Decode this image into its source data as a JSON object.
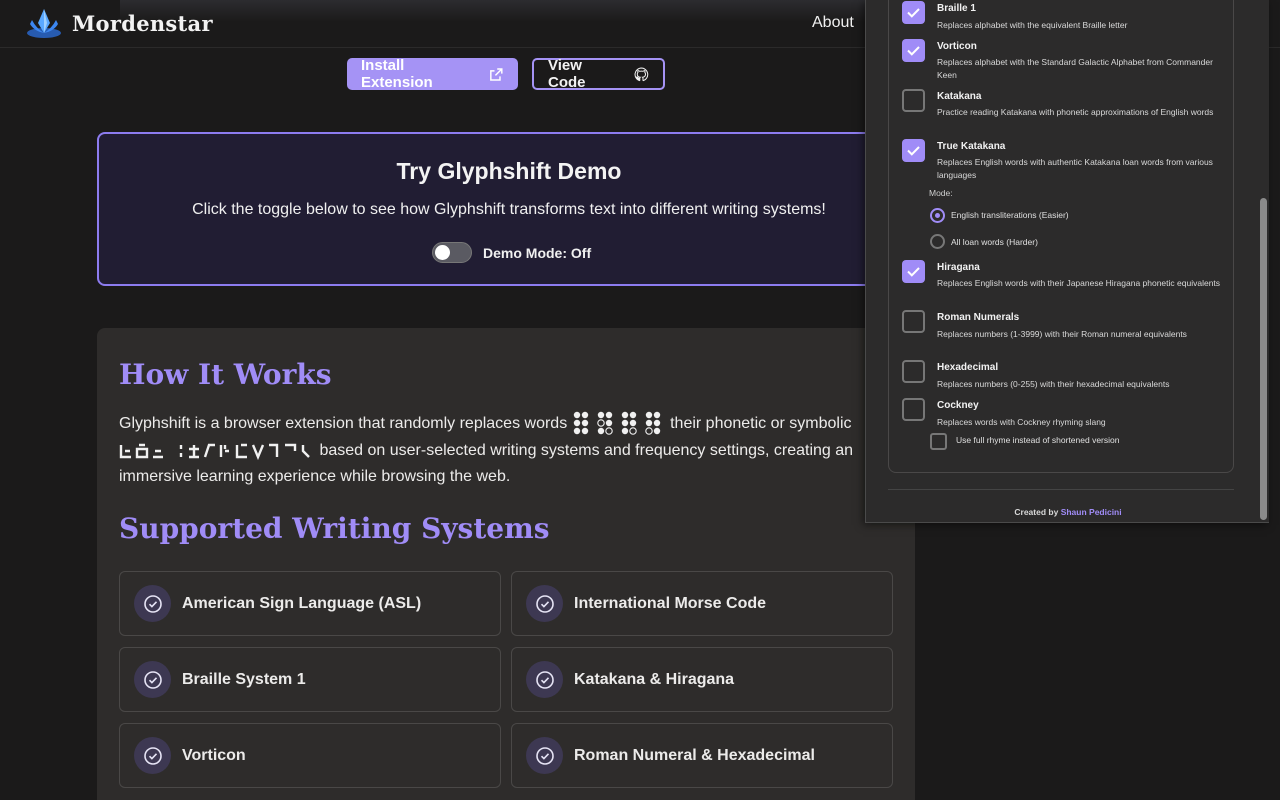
{
  "header": {
    "brand": "Mordenstar",
    "nav_about": "About",
    "install_button": "Install Extension",
    "code_button": "View Code"
  },
  "demo": {
    "title": "Try Glyphshift Demo",
    "subtitle": "Click the toggle below to see how Glyphshift transforms text into different writing systems!",
    "toggle_label": "Demo Mode: Off",
    "toggle_on": false
  },
  "how": {
    "heading": "How It Works",
    "text_a": "Glyphshift is a browser extension that randomly replaces words",
    "text_b": "their phonetic or symbolic",
    "text_c": "based on user-selected writing systems and frequency settings, creating an immersive learning experience while browsing the web."
  },
  "supported": {
    "heading": "Supported Writing Systems",
    "systems": [
      "American Sign Language (ASL)",
      "International Morse Code",
      "Braille System 1",
      "Katakana & Hiragana",
      "Vorticon",
      "Roman Numeral & Hexadecimal"
    ]
  },
  "popup": {
    "options": [
      {
        "title": "Braille 1",
        "desc": "Replaces alphabet with the equivalent Braille letter",
        "checked": true
      },
      {
        "title": "Vorticon",
        "desc": "Replaces alphabet with the Standard Galactic Alphabet from Commander Keen",
        "checked": true
      },
      {
        "title": "Katakana",
        "desc": "Practice reading Katakana with phonetic approximations of English words",
        "checked": false
      },
      {
        "title": "True Katakana",
        "desc": "Replaces English words with authentic Katakana loan words from various languages",
        "checked": true
      },
      {
        "title": "Hiragana",
        "desc": "Replaces English words with their Japanese Hiragana phonetic equivalents",
        "checked": true
      },
      {
        "title": "Roman Numerals",
        "desc": "Replaces numbers (1-3999) with their Roman numeral equivalents",
        "checked": false
      },
      {
        "title": "Hexadecimal",
        "desc": "Replaces numbers (0-255) with their hexadecimal equivalents",
        "checked": false
      },
      {
        "title": "Cockney",
        "desc": "Replaces words with Cockney rhyming slang",
        "checked": false
      }
    ],
    "mode_label": "Mode:",
    "mode_options": [
      "English transliterations (Easier)",
      "All loan words (Harder)"
    ],
    "mode_selected": "English transliterations (Easier)",
    "cockney_sub": "Use full rhyme instead of shortened version",
    "credit_prefix": "Created by",
    "credit_name": "Shaun Pedicini"
  },
  "colors": {
    "accent": "#a593f5",
    "background": "#1b1a1a",
    "card_bg": "#2e2c2b",
    "demo_bg": "#211d33"
  },
  "icons": {
    "logo": "crystal-flame-logo",
    "install": "external-link-icon",
    "code": "github-icon",
    "card": "check-circle-icon"
  }
}
